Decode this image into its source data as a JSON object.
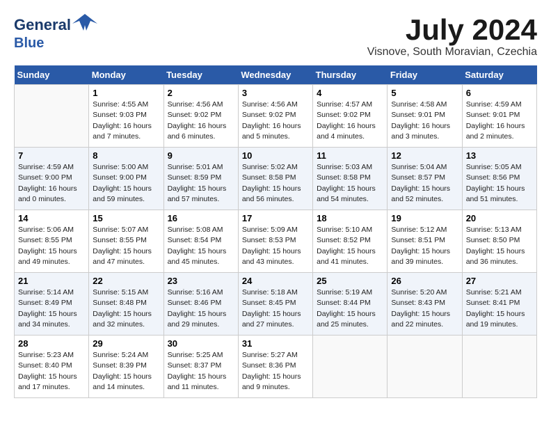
{
  "header": {
    "logo_line1": "General",
    "logo_line2": "Blue",
    "month": "July 2024",
    "location": "Visnove, South Moravian, Czechia"
  },
  "weekdays": [
    "Sunday",
    "Monday",
    "Tuesday",
    "Wednesday",
    "Thursday",
    "Friday",
    "Saturday"
  ],
  "weeks": [
    [
      {
        "day": "",
        "info": ""
      },
      {
        "day": "1",
        "info": "Sunrise: 4:55 AM\nSunset: 9:03 PM\nDaylight: 16 hours\nand 7 minutes."
      },
      {
        "day": "2",
        "info": "Sunrise: 4:56 AM\nSunset: 9:02 PM\nDaylight: 16 hours\nand 6 minutes."
      },
      {
        "day": "3",
        "info": "Sunrise: 4:56 AM\nSunset: 9:02 PM\nDaylight: 16 hours\nand 5 minutes."
      },
      {
        "day": "4",
        "info": "Sunrise: 4:57 AM\nSunset: 9:02 PM\nDaylight: 16 hours\nand 4 minutes."
      },
      {
        "day": "5",
        "info": "Sunrise: 4:58 AM\nSunset: 9:01 PM\nDaylight: 16 hours\nand 3 minutes."
      },
      {
        "day": "6",
        "info": "Sunrise: 4:59 AM\nSunset: 9:01 PM\nDaylight: 16 hours\nand 2 minutes."
      }
    ],
    [
      {
        "day": "7",
        "info": "Sunrise: 4:59 AM\nSunset: 9:00 PM\nDaylight: 16 hours\nand 0 minutes."
      },
      {
        "day": "8",
        "info": "Sunrise: 5:00 AM\nSunset: 9:00 PM\nDaylight: 15 hours\nand 59 minutes."
      },
      {
        "day": "9",
        "info": "Sunrise: 5:01 AM\nSunset: 8:59 PM\nDaylight: 15 hours\nand 57 minutes."
      },
      {
        "day": "10",
        "info": "Sunrise: 5:02 AM\nSunset: 8:58 PM\nDaylight: 15 hours\nand 56 minutes."
      },
      {
        "day": "11",
        "info": "Sunrise: 5:03 AM\nSunset: 8:58 PM\nDaylight: 15 hours\nand 54 minutes."
      },
      {
        "day": "12",
        "info": "Sunrise: 5:04 AM\nSunset: 8:57 PM\nDaylight: 15 hours\nand 52 minutes."
      },
      {
        "day": "13",
        "info": "Sunrise: 5:05 AM\nSunset: 8:56 PM\nDaylight: 15 hours\nand 51 minutes."
      }
    ],
    [
      {
        "day": "14",
        "info": "Sunrise: 5:06 AM\nSunset: 8:55 PM\nDaylight: 15 hours\nand 49 minutes."
      },
      {
        "day": "15",
        "info": "Sunrise: 5:07 AM\nSunset: 8:55 PM\nDaylight: 15 hours\nand 47 minutes."
      },
      {
        "day": "16",
        "info": "Sunrise: 5:08 AM\nSunset: 8:54 PM\nDaylight: 15 hours\nand 45 minutes."
      },
      {
        "day": "17",
        "info": "Sunrise: 5:09 AM\nSunset: 8:53 PM\nDaylight: 15 hours\nand 43 minutes."
      },
      {
        "day": "18",
        "info": "Sunrise: 5:10 AM\nSunset: 8:52 PM\nDaylight: 15 hours\nand 41 minutes."
      },
      {
        "day": "19",
        "info": "Sunrise: 5:12 AM\nSunset: 8:51 PM\nDaylight: 15 hours\nand 39 minutes."
      },
      {
        "day": "20",
        "info": "Sunrise: 5:13 AM\nSunset: 8:50 PM\nDaylight: 15 hours\nand 36 minutes."
      }
    ],
    [
      {
        "day": "21",
        "info": "Sunrise: 5:14 AM\nSunset: 8:49 PM\nDaylight: 15 hours\nand 34 minutes."
      },
      {
        "day": "22",
        "info": "Sunrise: 5:15 AM\nSunset: 8:48 PM\nDaylight: 15 hours\nand 32 minutes."
      },
      {
        "day": "23",
        "info": "Sunrise: 5:16 AM\nSunset: 8:46 PM\nDaylight: 15 hours\nand 29 minutes."
      },
      {
        "day": "24",
        "info": "Sunrise: 5:18 AM\nSunset: 8:45 PM\nDaylight: 15 hours\nand 27 minutes."
      },
      {
        "day": "25",
        "info": "Sunrise: 5:19 AM\nSunset: 8:44 PM\nDaylight: 15 hours\nand 25 minutes."
      },
      {
        "day": "26",
        "info": "Sunrise: 5:20 AM\nSunset: 8:43 PM\nDaylight: 15 hours\nand 22 minutes."
      },
      {
        "day": "27",
        "info": "Sunrise: 5:21 AM\nSunset: 8:41 PM\nDaylight: 15 hours\nand 19 minutes."
      }
    ],
    [
      {
        "day": "28",
        "info": "Sunrise: 5:23 AM\nSunset: 8:40 PM\nDaylight: 15 hours\nand 17 minutes."
      },
      {
        "day": "29",
        "info": "Sunrise: 5:24 AM\nSunset: 8:39 PM\nDaylight: 15 hours\nand 14 minutes."
      },
      {
        "day": "30",
        "info": "Sunrise: 5:25 AM\nSunset: 8:37 PM\nDaylight: 15 hours\nand 11 minutes."
      },
      {
        "day": "31",
        "info": "Sunrise: 5:27 AM\nSunset: 8:36 PM\nDaylight: 15 hours\nand 9 minutes."
      },
      {
        "day": "",
        "info": ""
      },
      {
        "day": "",
        "info": ""
      },
      {
        "day": "",
        "info": ""
      }
    ]
  ]
}
